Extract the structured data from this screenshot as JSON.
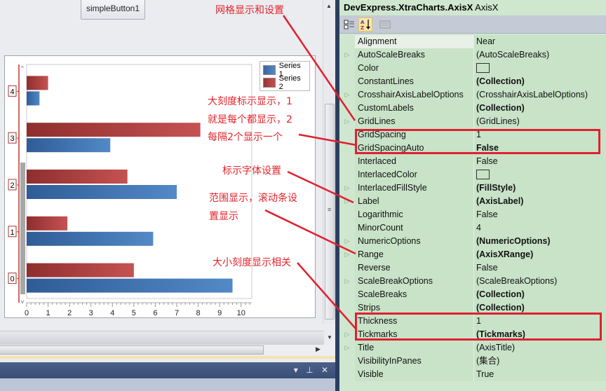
{
  "designer": {
    "button_label": "simpleButton1"
  },
  "chart_data": {
    "type": "bar",
    "orientation": "horizontal",
    "categories": [
      "0",
      "1",
      "2",
      "3",
      "4"
    ],
    "series": [
      {
        "name": "Series 1",
        "color": "#3f70ad",
        "values": [
          9.6,
          5.9,
          7.0,
          3.9,
          0.6
        ]
      },
      {
        "name": "Series 2",
        "color": "#b03c3c",
        "values": [
          5.0,
          1.9,
          4.7,
          8.1,
          1.0
        ]
      }
    ],
    "value_axis_ticks": [
      "0",
      "1",
      "2",
      "3",
      "4",
      "5",
      "6",
      "7",
      "8",
      "9",
      "10"
    ],
    "xlim": [
      0,
      10.5
    ],
    "legend": "top-right",
    "title": "",
    "xlabel": "",
    "ylabel": ""
  },
  "dock": {
    "controls": "▾ ⊥ ✕"
  },
  "propgrid": {
    "title_type": "DevExpress.XtraCharts.AxisX",
    "title_name": "AxisX",
    "toolbar": {
      "categorized": "categorized-view",
      "alphabetical": "alphabetical-view",
      "pages": "property-pages"
    },
    "rows": [
      {
        "name": "Alignment",
        "value": "Near",
        "expandable": false,
        "bold": false
      },
      {
        "name": "AutoScaleBreaks",
        "value": "(AutoScaleBreaks)",
        "expandable": true,
        "bold": false
      },
      {
        "name": "Color",
        "value": "",
        "expandable": false,
        "bold": false,
        "color_swatch": true
      },
      {
        "name": "ConstantLines",
        "value": "(Collection)",
        "expandable": false,
        "bold": true
      },
      {
        "name": "CrosshairAxisLabelOptions",
        "value": "(CrosshairAxisLabelOptions)",
        "expandable": true,
        "bold": false
      },
      {
        "name": "CustomLabels",
        "value": "(Collection)",
        "expandable": false,
        "bold": true
      },
      {
        "name": "GridLines",
        "value": "(GridLines)",
        "expandable": true,
        "bold": false
      },
      {
        "name": "GridSpacing",
        "value": "1",
        "expandable": false,
        "bold": false
      },
      {
        "name": "GridSpacingAuto",
        "value": "False",
        "expandable": false,
        "bold": true
      },
      {
        "name": "Interlaced",
        "value": "False",
        "expandable": false,
        "bold": false
      },
      {
        "name": "InterlacedColor",
        "value": "",
        "expandable": false,
        "bold": false,
        "color_swatch": true
      },
      {
        "name": "InterlacedFillStyle",
        "value": "(FillStyle)",
        "expandable": true,
        "bold": true
      },
      {
        "name": "Label",
        "value": "(AxisLabel)",
        "expandable": true,
        "bold": true
      },
      {
        "name": "Logarithmic",
        "value": "False",
        "expandable": false,
        "bold": false
      },
      {
        "name": "MinorCount",
        "value": "4",
        "expandable": false,
        "bold": false
      },
      {
        "name": "NumericOptions",
        "value": "(NumericOptions)",
        "expandable": true,
        "bold": true
      },
      {
        "name": "Range",
        "value": "(AxisXRange)",
        "expandable": true,
        "bold": true
      },
      {
        "name": "Reverse",
        "value": "False",
        "expandable": false,
        "bold": false
      },
      {
        "name": "ScaleBreakOptions",
        "value": "(ScaleBreakOptions)",
        "expandable": true,
        "bold": false
      },
      {
        "name": "ScaleBreaks",
        "value": "(Collection)",
        "expandable": false,
        "bold": true
      },
      {
        "name": "Strips",
        "value": "(Collection)",
        "expandable": false,
        "bold": true
      },
      {
        "name": "Thickness",
        "value": "1",
        "expandable": false,
        "bold": false
      },
      {
        "name": "Tickmarks",
        "value": "(Tickmarks)",
        "expandable": true,
        "bold": true
      },
      {
        "name": "Title",
        "value": "(AxisTitle)",
        "expandable": true,
        "bold": false
      },
      {
        "name": "VisibilityInPanes",
        "value": "(集合)",
        "expandable": false,
        "bold": false
      },
      {
        "name": "Visible",
        "value": "True",
        "expandable": false,
        "bold": false
      }
    ]
  },
  "annotations": {
    "grid": "网格显示和设置",
    "major_tick_1": "大刻度标示显示，1",
    "major_tick_2": "就是每个都显示，2",
    "major_tick_3": "每隔2个显示一个",
    "label_font": "标示字体设置",
    "range_1": "范围显示，滚动条设",
    "range_2": "置显示",
    "tick_size": "大小刻度显示相关",
    "color": "#e3242b"
  }
}
